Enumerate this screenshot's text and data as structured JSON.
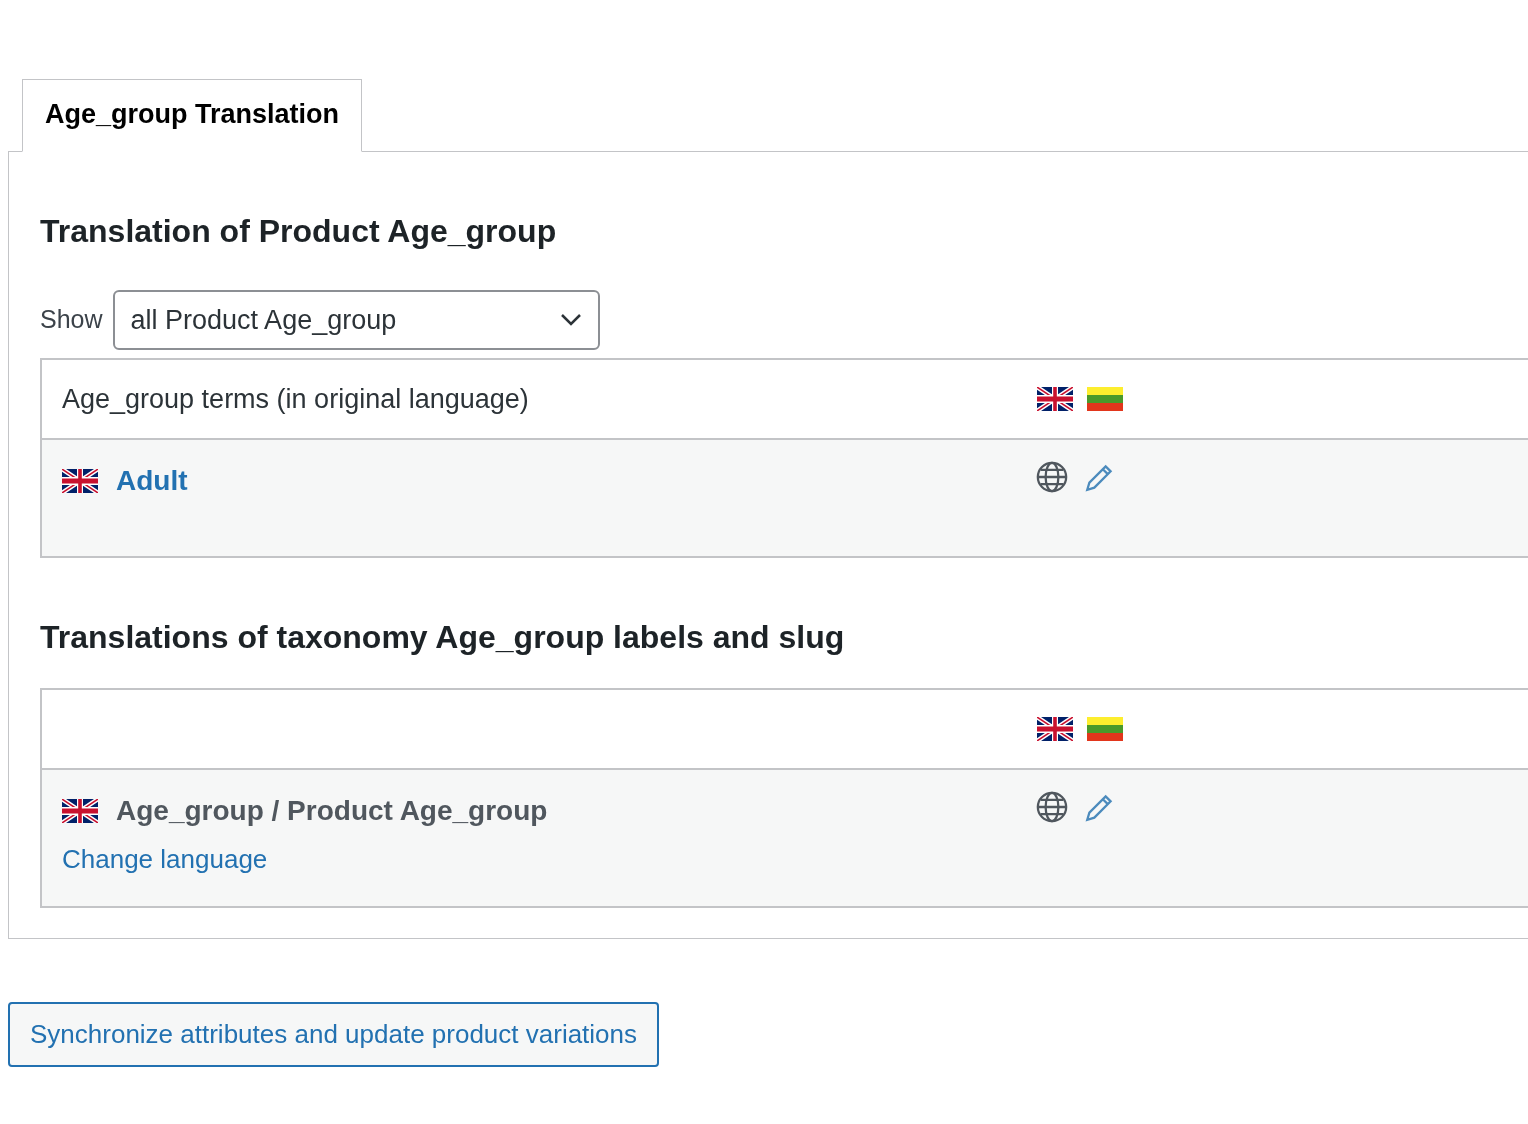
{
  "tabs": [
    {
      "label": "Age_group Translation",
      "selected": true
    }
  ],
  "sections": [
    {
      "title": "Translation of Product Age_group",
      "filter": {
        "label": "Show",
        "value": "all Product Age_group"
      },
      "header": {
        "label": "Age_group terms (in original language)",
        "languages": [
          {
            "kind": "uk"
          },
          {
            "kind": "lt"
          }
        ]
      },
      "rows": [
        {
          "flag": {
            "kind": "uk"
          },
          "name": "Adult",
          "kind": "link"
        }
      ]
    },
    {
      "title": "Translations of taxonomy Age_group labels and slug",
      "header": {
        "languages": [
          {
            "kind": "uk"
          },
          {
            "kind": "lt"
          }
        ]
      },
      "rows": [
        {
          "flag": {
            "kind": "uk"
          },
          "name": "Age_group / Product Age_group",
          "kind": "label",
          "link": "Change language"
        }
      ]
    }
  ],
  "button": "Synchronize attributes and update product variations"
}
